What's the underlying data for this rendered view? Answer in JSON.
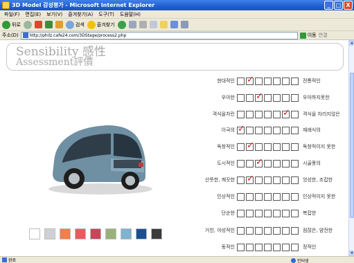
{
  "window": {
    "title": "3D Model 감성평가 - Microsoft Internet Explorer",
    "buttons": [
      "_",
      "□",
      "X"
    ]
  },
  "menu": [
    "파일(F)",
    "편집(E)",
    "보기(V)",
    "즐겨찾기(A)",
    "도구(T)",
    "도움말(H)"
  ],
  "toolbar": {
    "back_label": "뒤로",
    "search_label": "검색",
    "favorites_label": "즐겨찾기"
  },
  "address": {
    "label": "주소(D)",
    "url": "http://philz.cafe24.com/3DStage/process2.php",
    "go_label": "이동",
    "links_label": "연결"
  },
  "page": {
    "title_line1": "Sensibility 感性",
    "title_line2": "Assessment評價"
  },
  "swatch_colors": [
    "#ffffff",
    "#cfcfd6",
    "#f07f4d",
    "#e85c5f",
    "#c54758",
    "#99b27a",
    "#7fb3cf",
    "#1c4f8f",
    "#3b3b3b"
  ],
  "ratings": [
    {
      "left": "현대적인",
      "right": "전통적인",
      "selected": 1
    },
    {
      "left": "우아한",
      "right": "우아하지못한",
      "selected": 2
    },
    {
      "left": "격식을차린",
      "right": "격식을 차리지않은",
      "selected": 5
    },
    {
      "left": "이국의",
      "right": "재래식의",
      "selected": 0
    },
    {
      "left": "독창적인",
      "right": "독창적이지 못한",
      "selected": 1
    },
    {
      "left": "도시적인",
      "right": "시골풍의",
      "selected": 2
    },
    {
      "left": "산뜻한, 깨끗한",
      "right": "엉성한, 조잡한",
      "selected": 1
    },
    {
      "left": "인상적인",
      "right": "인상적이지 못한",
      "selected": -1
    },
    {
      "left": "단순한",
      "right": "복잡한",
      "selected": -1
    },
    {
      "left": "거친, 야성적인",
      "right": "점잖은, 얌전한",
      "selected": -1
    },
    {
      "left": "동적인",
      "right": "정적인",
      "selected": -1
    }
  ],
  "status": {
    "text": "완료",
    "zone": "인터넷"
  }
}
